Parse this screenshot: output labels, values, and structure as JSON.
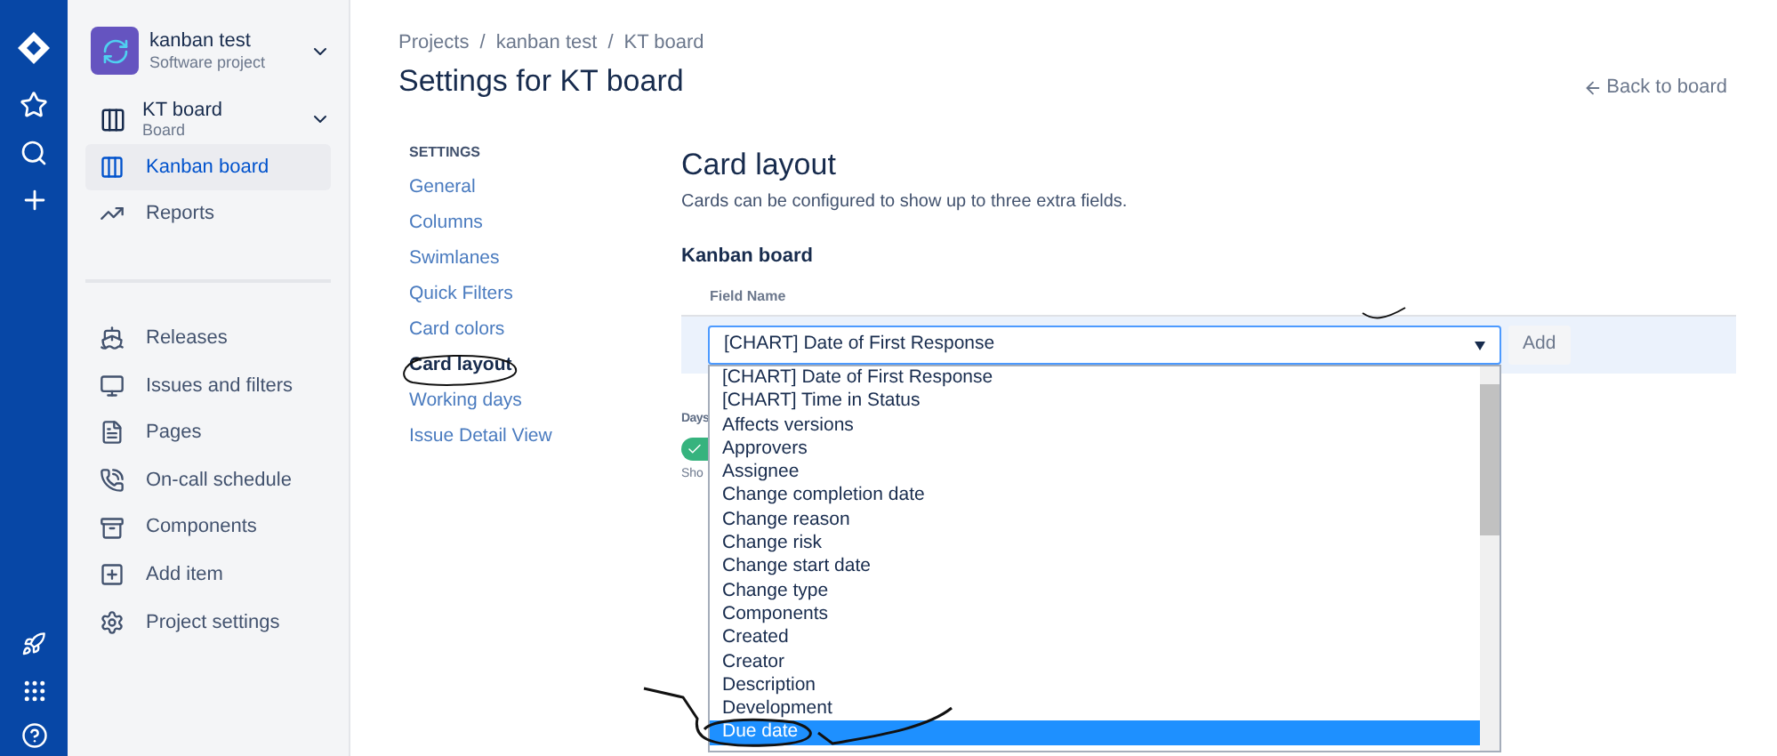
{
  "project": {
    "name": "kanban test",
    "type": "Software project"
  },
  "board": {
    "name": "KT board",
    "type": "Board"
  },
  "sidebar": {
    "items": [
      {
        "label": "Kanban board",
        "selected": true
      },
      {
        "label": "Reports",
        "selected": false
      }
    ],
    "lower_items": [
      {
        "label": "Releases"
      },
      {
        "label": "Issues and filters"
      },
      {
        "label": "Pages"
      },
      {
        "label": "On-call schedule"
      },
      {
        "label": "Components"
      },
      {
        "label": "Add item"
      },
      {
        "label": "Project settings"
      }
    ]
  },
  "breadcrumbs": [
    {
      "label": "Projects",
      "separator": "/"
    },
    {
      "label": "kanban test",
      "separator": "/"
    },
    {
      "label": "KT board"
    }
  ],
  "page_title": "Settings for KT board",
  "back_link": "Back to board",
  "settings_nav": {
    "heading": "SETTINGS",
    "items": [
      {
        "label": "General",
        "selected": false
      },
      {
        "label": "Columns",
        "selected": false
      },
      {
        "label": "Swimlanes",
        "selected": false
      },
      {
        "label": "Quick Filters",
        "selected": false
      },
      {
        "label": "Card colors",
        "selected": false
      },
      {
        "label": "Card layout",
        "selected": true
      },
      {
        "label": "Working days",
        "selected": false
      },
      {
        "label": "Issue Detail View",
        "selected": false
      }
    ]
  },
  "content": {
    "title": "Card layout",
    "description": "Cards can be configured to show up to three extra fields.",
    "section": "Kanban board",
    "field_label": "Field Name",
    "select_value": "[CHART] Date of First Response",
    "add_button": "Add",
    "behind_label": "Days",
    "toggle": {
      "on": true
    },
    "behind_hint": "Sho",
    "options": [
      {
        "label": "[CHART] Date of First Response",
        "selected": false
      },
      {
        "label": "[CHART] Time in Status",
        "selected": false
      },
      {
        "label": "Affects versions",
        "selected": false
      },
      {
        "label": "Approvers",
        "selected": false
      },
      {
        "label": "Assignee",
        "selected": false
      },
      {
        "label": "Change completion date",
        "selected": false
      },
      {
        "label": "Change reason",
        "selected": false
      },
      {
        "label": "Change risk",
        "selected": false
      },
      {
        "label": "Change start date",
        "selected": false
      },
      {
        "label": "Change type",
        "selected": false
      },
      {
        "label": "Components",
        "selected": false
      },
      {
        "label": "Created",
        "selected": false
      },
      {
        "label": "Creator",
        "selected": false
      },
      {
        "label": "Description",
        "selected": false
      },
      {
        "label": "Development",
        "selected": false
      },
      {
        "label": "Due date",
        "selected": true
      }
    ]
  }
}
